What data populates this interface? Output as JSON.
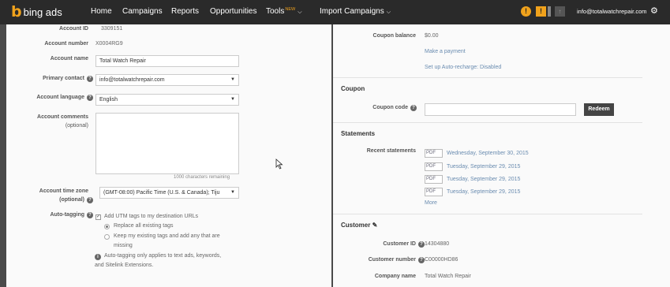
{
  "topbar": {
    "logo_icon": "b",
    "logo_text": "bing ads",
    "nav": {
      "home": "Home",
      "campaigns": "Campaigns",
      "reports": "Reports",
      "opportunities": "Opportunities",
      "tools": "Tools",
      "tools_badge": "NEW",
      "import": "Import Campaigns"
    },
    "alert_info": "!",
    "alert_warn": "!",
    "user_email": "info@totalwatchrepair.com"
  },
  "account": {
    "id_label": "Account ID",
    "id_value": "3309151",
    "number_label": "Account number",
    "number_value": "X0004RG9",
    "name_label": "Account name",
    "name_value": "Total Watch Repair",
    "contact_label": "Primary contact",
    "contact_value": "info@totalwatchrepair.com",
    "language_label": "Account language",
    "language_value": "English",
    "comments_label": "Account comments",
    "comments_optional": "(optional)",
    "comments_value": "",
    "chars_remaining": "1000 characters remaining",
    "timezone_label": "Account time zone",
    "timezone_optional": "(optional)",
    "timezone_value": "(GMT-08:00) Pacific Time (U.S. & Canada); Tiju",
    "autotag_label": "Auto-tagging",
    "autotag_add": "Add UTM tags to my destination URLs",
    "autotag_replace": "Replace all existing tags",
    "autotag_keep": "Keep my existing tags and add any that are",
    "autotag_keep2": "missing",
    "autotag_note": "Auto-tagging only applies to text ads, keywords,",
    "autotag_note2": "and Sitelink Extensions."
  },
  "billing": {
    "coupon_balance_label": "Coupon balance",
    "coupon_balance_value": "$0.00",
    "make_payment": "Make a payment",
    "auto_recharge": "Set up Auto-recharge: Disabled"
  },
  "coupon": {
    "heading": "Coupon",
    "code_label": "Coupon code",
    "code_value": "",
    "redeem": "Redeem"
  },
  "statements": {
    "heading": "Statements",
    "recent_label": "Recent statements",
    "pdf_label": "PDF",
    "items": [
      "Wednesday, September 30, 2015",
      "Tuesday, September 29, 2015",
      "Tuesday, September 29, 2015",
      "Tuesday, September 29, 2015"
    ],
    "more": "More"
  },
  "customer": {
    "heading": "Customer",
    "id_label": "Customer ID",
    "id_value": "14304880",
    "number_label": "Customer number",
    "number_value": "C00000HD86",
    "company_label": "Company name",
    "company_value": "Total Watch Repair"
  },
  "colors": {
    "topbar": "#2a2a2a",
    "brand_orange": "#f0a21c",
    "link": "#6a8cb0"
  }
}
